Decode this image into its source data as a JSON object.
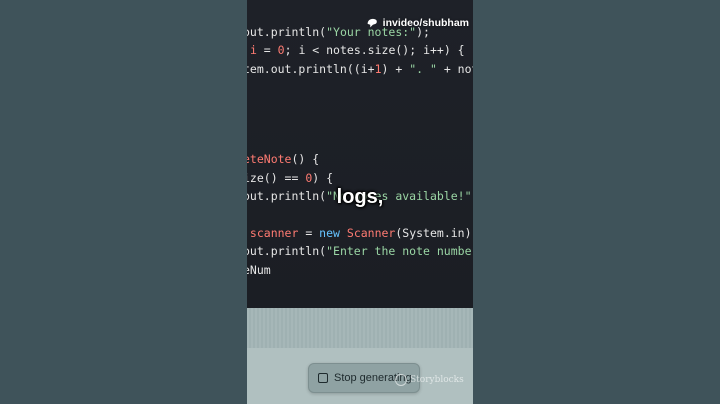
{
  "watermark": {
    "label": "invideo/shubham",
    "icon": "invideo-logo-icon"
  },
  "code": {
    "l1": {
      "a": "out.println(",
      "b": "\"Your notes:\"",
      "c": ");"
    },
    "l2": {
      "a": " ",
      "b": "i",
      "c": " = ",
      "d": "0",
      "e": "; i < notes.size(); i++) {"
    },
    "l3": {
      "a": "tem.out.println((i+",
      "b": "1",
      "c": ") + ",
      "d": "\". \"",
      "e": " + notes"
    },
    "l4": {
      "a": "eteNote",
      "b": "() {"
    },
    "l5": {
      "a": "ize() == ",
      "b": "0",
      "c": ") {"
    },
    "l6": {
      "a": "out.println(",
      "b": "\"No notes available!\"",
      "c": ");"
    },
    "l7": {
      "a": " scanner",
      "b": " = ",
      "c": "new",
      "d": " ",
      "e": "Scanner",
      "f": "(System.in);"
    },
    "l8": {
      "a": "out.println(",
      "b": "\"Enter the note number t"
    },
    "l9": {
      "a": "eNum"
    }
  },
  "caption": "logs,",
  "stop_button": {
    "label": "Stop generating",
    "icon": "stop-square-icon"
  },
  "storyblocks": {
    "label": "Storyblocks",
    "icon": "storyblocks-logo-icon"
  },
  "colors": {
    "keyword": "#ff7b72",
    "string": "#9ad5a4",
    "type": "#66c3ff",
    "code_bg": "#1e2128",
    "page_bg": "#3e5258"
  }
}
